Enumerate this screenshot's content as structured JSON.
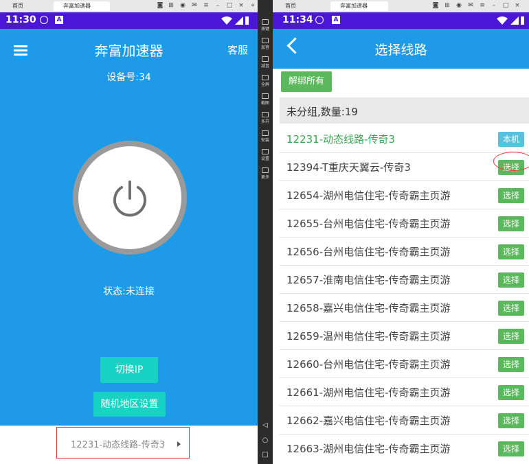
{
  "left": {
    "tabs": [
      "首页",
      "奔富加速器"
    ],
    "status_time": "11:30",
    "app_title": "奔富加速器",
    "kefu_label": "客服",
    "device_no": "设备号:34",
    "power_icon": "power-icon",
    "state_text": "状态:未连接",
    "switch_ip_label": "切换IP",
    "region_label": "随机地区设置",
    "current_route": "12231-动态线路-传奇3"
  },
  "side_toolbar": [
    "按键",
    "加音",
    "减音",
    "全屏",
    "截图",
    "多开",
    "安装",
    "设置",
    "更多"
  ],
  "right": {
    "tabs": [
      "首页",
      "奔富加速器"
    ],
    "status_time": "11:34",
    "title": "选择线路",
    "unbind_label": "解绑所有",
    "group_label": "未分组,数量:19",
    "routes": [
      {
        "name": "12231-动态线路-传奇3",
        "button": "本机"
      },
      {
        "name": "12394-T重庆天翼云-传奇3",
        "button": "选择"
      },
      {
        "name": "12654-湖州电信住宅-传奇霸主页游",
        "button": "选择"
      },
      {
        "name": "12655-台州电信住宅-传奇霸主页游",
        "button": "选择"
      },
      {
        "name": "12656-台州电信住宅-传奇霸主页游",
        "button": "选择"
      },
      {
        "name": "12657-淮南电信住宅-传奇霸主页游",
        "button": "选择"
      },
      {
        "name": "12658-嘉兴电信住宅-传奇霸主页游",
        "button": "选择"
      },
      {
        "name": "12659-温州电信住宅-传奇霸主页游",
        "button": "选择"
      },
      {
        "name": "12660-台州电信住宅-传奇霸主页游",
        "button": "选择"
      },
      {
        "name": "12661-湖州电信住宅-传奇霸主页游",
        "button": "选择"
      },
      {
        "name": "12662-嘉兴电信住宅-传奇霸主页游",
        "button": "选择"
      },
      {
        "name": "12663-湖州电信住宅-传奇霸主页游",
        "button": "选择"
      }
    ]
  },
  "colors": {
    "app_blue": "#1e9be8",
    "status_purple": "#4b17d6",
    "teal_button": "#18d2c3",
    "green_button": "#5cb85c",
    "blue_button": "#5bc0de",
    "highlight_red": "#e53935"
  }
}
